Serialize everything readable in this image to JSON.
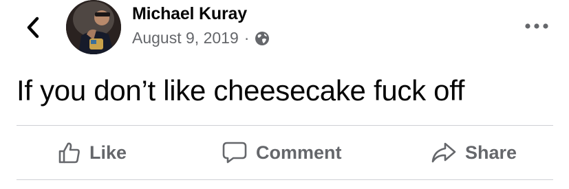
{
  "post": {
    "author": "Michael Kuray",
    "date": "August 9, 2019",
    "separator": "·",
    "audience_icon": "globe-icon",
    "text": "If you don’t like cheesecake fuck off"
  },
  "nav": {
    "back_icon": "chevron-left-icon",
    "more_icon": "more-horizontal-icon"
  },
  "actions": {
    "like_label": "Like",
    "comment_label": "Comment",
    "share_label": "Share"
  },
  "colors": {
    "text_primary": "#050505",
    "text_secondary": "#65676b",
    "divider": "#ced0d4",
    "background": "#ffffff"
  }
}
